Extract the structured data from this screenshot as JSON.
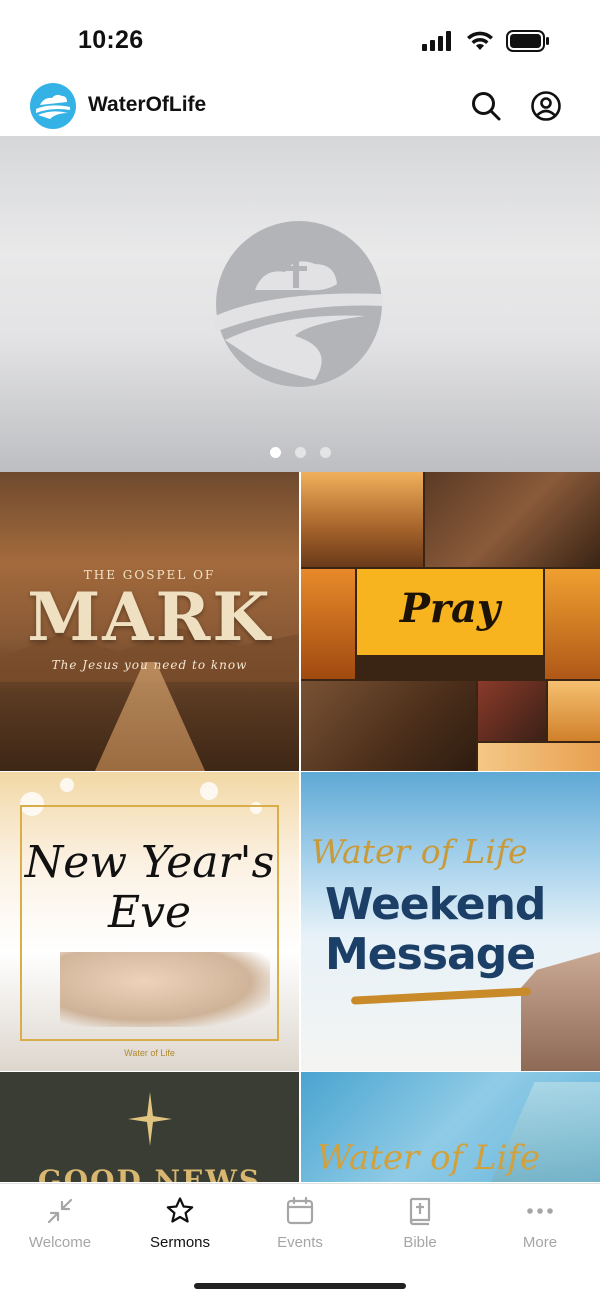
{
  "status_bar": {
    "time": "10:26"
  },
  "header": {
    "title": "WaterOfLife"
  },
  "carousel": {
    "dots": 3,
    "active": 0
  },
  "sermons": [
    {
      "subtitle": "THE GOSPEL OF",
      "title": "MARK",
      "tagline": "The Jesus you need to know"
    },
    {
      "title": "Pray"
    },
    {
      "title": "New Year's Eve",
      "footer": "Water of Life"
    },
    {
      "script": "Water of Life",
      "title": "Weekend Message"
    },
    {
      "title": "GOOD NEWS"
    },
    {
      "script": "Water of Life"
    }
  ],
  "tabs": [
    {
      "label": "Welcome",
      "icon": "arrows-collapse-icon"
    },
    {
      "label": "Sermons",
      "icon": "star-icon"
    },
    {
      "label": "Events",
      "icon": "calendar-icon"
    },
    {
      "label": "Bible",
      "icon": "bible-icon"
    },
    {
      "label": "More",
      "icon": "more-icon"
    }
  ],
  "active_tab": "Sermons",
  "colors": {
    "brand": "#35b2e5",
    "active_tab": "#111111",
    "inactive_tab": "#a6a6a6"
  }
}
